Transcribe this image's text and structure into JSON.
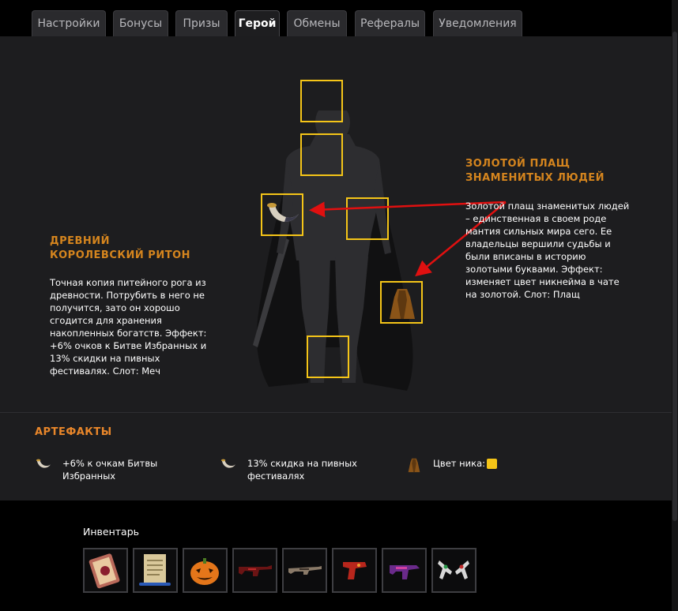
{
  "tabs": [
    {
      "label": "Настройки",
      "active": false
    },
    {
      "label": "Бонусы",
      "active": false
    },
    {
      "label": "Призы",
      "active": false
    },
    {
      "label": "Герой",
      "active": true
    },
    {
      "label": "Обмены",
      "active": false
    },
    {
      "label": "Рефералы",
      "active": false
    },
    {
      "label": "Уведомления",
      "active": false
    }
  ],
  "hero": {
    "weapon_item": {
      "title": "ДРЕВНИЙ КОРОЛЕВСКИЙ РИТОН",
      "description": "Точная копия питейного рога из древности. Потрубить в него не получится, зато он хорошо сгодится для хранения накопленных богатств. Эффект: +6% очков к Битве Избранных и 13% скидки на пивных фестивалях. Слот: Меч"
    },
    "cloak_item": {
      "title": "ЗОЛОТОЙ ПЛАЩ ЗНАМЕНИТЫХ ЛЮДЕЙ",
      "description": "Золотой плащ знаменитых людей – единственная в своем роде мантия сильных мира сего. Ее владельцы вершили судьбы и были вписаны в историю золотыми буквами. Эффект: изменяет цвет никнейма в чате на золотой. Слот: Плащ"
    }
  },
  "artifacts": {
    "title": "АРТЕФАКТЫ",
    "items": [
      {
        "icon": "horn-icon",
        "text": "+6% к очкам Битвы Избранных"
      },
      {
        "icon": "horn-icon",
        "text": "13% скидка на пивных фестивалях"
      },
      {
        "icon": "cloak-icon",
        "text": "Цвет ника:"
      }
    ],
    "nick_color": "#f5c518"
  },
  "inventory": {
    "label": "Инвентарь",
    "items": [
      "card-icon",
      "scroll-icon",
      "pumpkin-icon",
      "rifle-red-icon",
      "rifle-skin-icon",
      "pistol-red-icon",
      "smg-purple-icon",
      "dual-pistols-icon"
    ]
  },
  "colors": {
    "slot_border": "#f5c518",
    "item_title": "#d5851e",
    "arrow": "#e01010"
  }
}
